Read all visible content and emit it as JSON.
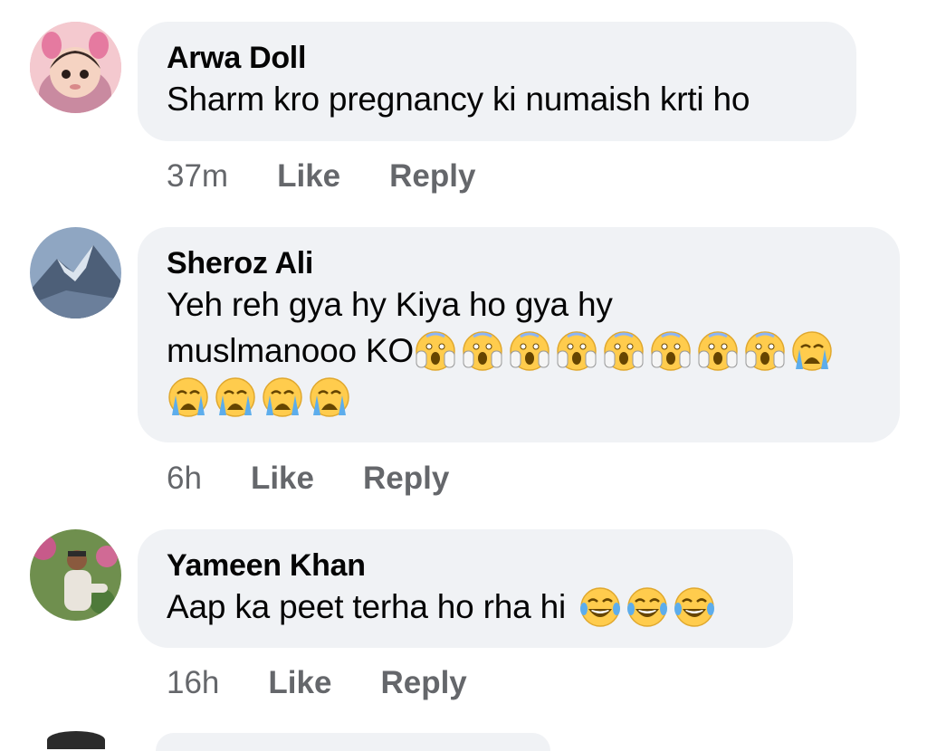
{
  "comments": [
    {
      "name": "Arwa Doll",
      "text": "Sharm kro pregnancy ki numaish krti ho",
      "time": "37m",
      "like": "Like",
      "reply": "Reply",
      "avatar": "girl-with-bunny-ears-filter"
    },
    {
      "name": "Sheroz Ali",
      "text_line1": "Yeh reh gya hy Kiya ho gya hy",
      "text_line2": "muslmanooo KO",
      "emojis_line2": [
        "face-screaming-icon",
        "face-screaming-icon",
        "face-screaming-icon",
        "face-screaming-icon",
        "face-screaming-icon",
        "face-screaming-icon",
        "face-screaming-icon",
        "face-screaming-icon",
        "crying-face-icon"
      ],
      "emojis_line3": [
        "crying-face-icon",
        "crying-face-icon",
        "crying-face-icon",
        "crying-face-icon"
      ],
      "time": "6h",
      "like": "Like",
      "reply": "Reply",
      "avatar": "mountain-landscape"
    },
    {
      "name": "Yameen Khan",
      "text": "Aap ka peet terha ho rha hi",
      "emojis": [
        "laughing-tears-icon",
        "laughing-tears-icon",
        "laughing-tears-icon"
      ],
      "time": "16h",
      "like": "Like",
      "reply": "Reply",
      "avatar": "man-sitting-outdoors"
    }
  ],
  "colors": {
    "bubble": "#f0f2f5",
    "meta": "#65676b",
    "name": "#050505"
  }
}
